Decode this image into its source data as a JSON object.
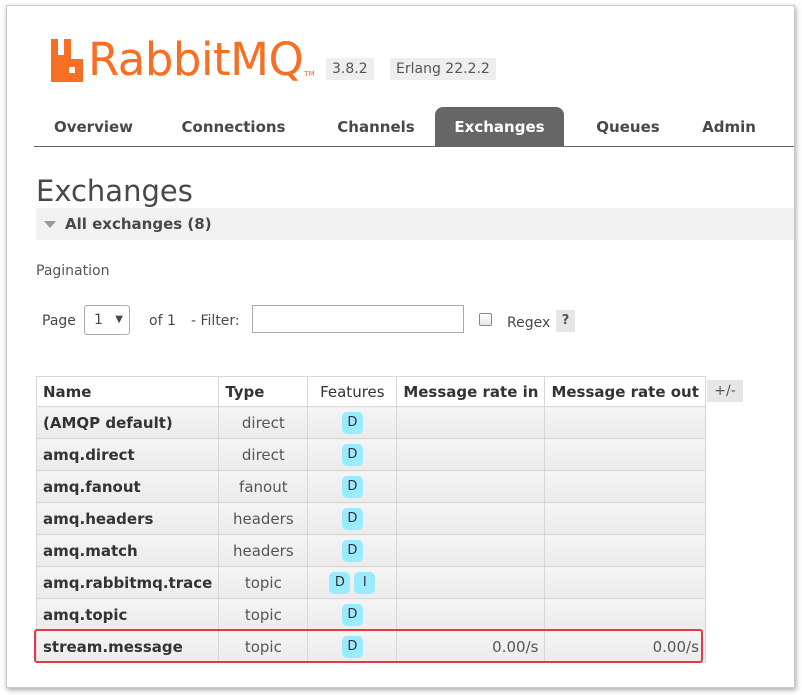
{
  "header": {
    "logo_text": "RabbitMQ",
    "logo_tm": "TM",
    "version": "3.8.2",
    "erlang": "Erlang 22.2.2"
  },
  "tabs": [
    {
      "label": "Overview",
      "active": false
    },
    {
      "label": "Connections",
      "active": false
    },
    {
      "label": "Channels",
      "active": false
    },
    {
      "label": "Exchanges",
      "active": true
    },
    {
      "label": "Queues",
      "active": false
    },
    {
      "label": "Admin",
      "active": false
    }
  ],
  "page": {
    "title": "Exchanges",
    "section_label": "All exchanges (8)",
    "pagination_label": "Pagination"
  },
  "pagination": {
    "page_label": "Page",
    "page_value": "1",
    "of_label": "of 1",
    "filter_label": "- Filter:",
    "filter_value": "",
    "regex_label": "Regex",
    "help_label": "?"
  },
  "table": {
    "headers": [
      "Name",
      "Type",
      "Features",
      "Message rate in",
      "Message rate out"
    ],
    "toggle_label": "+/-",
    "rows": [
      {
        "name": "(AMQP default)",
        "type": "direct",
        "features": [
          "D"
        ],
        "rate_in": "",
        "rate_out": ""
      },
      {
        "name": "amq.direct",
        "type": "direct",
        "features": [
          "D"
        ],
        "rate_in": "",
        "rate_out": ""
      },
      {
        "name": "amq.fanout",
        "type": "fanout",
        "features": [
          "D"
        ],
        "rate_in": "",
        "rate_out": ""
      },
      {
        "name": "amq.headers",
        "type": "headers",
        "features": [
          "D"
        ],
        "rate_in": "",
        "rate_out": ""
      },
      {
        "name": "amq.match",
        "type": "headers",
        "features": [
          "D"
        ],
        "rate_in": "",
        "rate_out": ""
      },
      {
        "name": "amq.rabbitmq.trace",
        "type": "topic",
        "features": [
          "D",
          "I"
        ],
        "rate_in": "",
        "rate_out": ""
      },
      {
        "name": "amq.topic",
        "type": "topic",
        "features": [
          "D"
        ],
        "rate_in": "",
        "rate_out": ""
      },
      {
        "name": "stream.message",
        "type": "topic",
        "features": [
          "D"
        ],
        "rate_in": "0.00/s",
        "rate_out": "0.00/s"
      }
    ]
  },
  "colors": {
    "brand": "#f76f24",
    "active_tab": "#666666",
    "feature_badge": "#99ebff",
    "highlight": "#e23b47"
  }
}
